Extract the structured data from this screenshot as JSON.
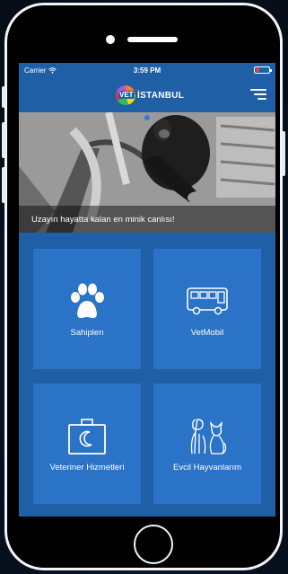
{
  "status_bar": {
    "carrier": "Carrier",
    "time": "3:59 PM"
  },
  "header": {
    "logo_mark": "VET",
    "logo_text": "İSTANBUL"
  },
  "banner": {
    "caption": "Uzayın hayatta kalan en minik canlısı!",
    "slide_index": 1
  },
  "tiles": [
    {
      "label": "Sahiplen",
      "icon": "paw-icon"
    },
    {
      "label": "VetMobil",
      "icon": "bus-icon"
    },
    {
      "label": "Veteriner Hizmetleri",
      "icon": "vet-case-icon"
    },
    {
      "label": "Evcil Hayvanlarım",
      "icon": "dog-cat-icon"
    }
  ],
  "colors": {
    "screen_background": "#1f5fa6",
    "tile_background": "#2b73c6",
    "page_background": "#081524",
    "battery_low": "#ff3b30"
  }
}
